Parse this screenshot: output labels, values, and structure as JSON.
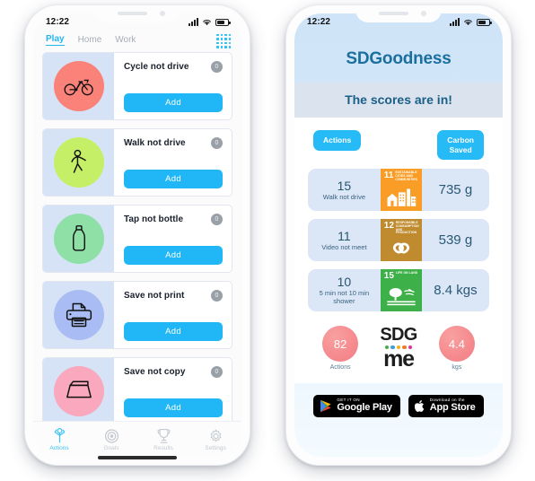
{
  "left_phone": {
    "status": {
      "time": "12:22",
      "signal_icon": "signal-bars-icon",
      "wifi_icon": "wifi-icon",
      "battery_icon": "battery-icon"
    },
    "topnav": {
      "tabs": [
        {
          "label": "Play",
          "active": true
        },
        {
          "label": "Home",
          "active": false
        },
        {
          "label": "Work",
          "active": false
        }
      ],
      "grid_icon": "grid-menu-icon"
    },
    "cards": [
      {
        "title": "Cycle not drive",
        "badge": "0",
        "button": "Add",
        "icon": "bicycle-icon",
        "circle_color": "#fa8279"
      },
      {
        "title": "Walk not drive",
        "badge": "0",
        "button": "Add",
        "icon": "walking-person-icon",
        "circle_color": "#c5ef66"
      },
      {
        "title": "Tap not bottle",
        "badge": "0",
        "button": "Add",
        "icon": "water-bottle-icon",
        "circle_color": "#8fe0a6"
      },
      {
        "title": "Save not print",
        "badge": "0",
        "button": "Add",
        "icon": "printer-icon",
        "circle_color": "#a9bdf4"
      },
      {
        "title": "Save not copy",
        "badge": "0",
        "button": "Add",
        "icon": "photocopier-icon",
        "circle_color": "#f9a8bd"
      }
    ],
    "tabbar": [
      {
        "label": "Actions",
        "icon": "person-actions-icon",
        "active": true
      },
      {
        "label": "Goals",
        "icon": "target-icon",
        "active": false
      },
      {
        "label": "Results",
        "icon": "trophy-icon",
        "active": false
      },
      {
        "label": "Settings",
        "icon": "gear-icon",
        "active": false
      }
    ]
  },
  "right_phone": {
    "status": {
      "time": "12:22",
      "signal_icon": "signal-bars-icon",
      "wifi_icon": "wifi-icon",
      "battery_icon": "battery-icon"
    },
    "app_title": "SDGoodness",
    "banner": "The scores are in!",
    "chips": {
      "actions": "Actions",
      "carbon": "Carbon\nSaved",
      "carbon_line1": "Carbon",
      "carbon_line2": "Saved"
    },
    "score_rows": [
      {
        "count": "15",
        "label": "Walk not drive",
        "value": "735 g",
        "sdg_number": "11",
        "sdg_text": "SUSTAINABLE CITIES AND COMMUNITIES",
        "sdg_color": "#f99d26",
        "sdg_icon": "sdg-cities-icon"
      },
      {
        "count": "11",
        "label": "Video not meet",
        "value": "539 g",
        "sdg_number": "12",
        "sdg_text": "RESPONSIBLE CONSUMPTION AND PRODUCTION",
        "sdg_color": "#bf8b2e",
        "sdg_icon": "sdg-infinity-icon"
      },
      {
        "count": "10",
        "label": "5 min not 10 min shower",
        "value": "8.4 kgs",
        "sdg_number": "15",
        "sdg_text": "LIFE ON LAND",
        "sdg_color": "#3eb049",
        "sdg_icon": "sdg-life-on-land-icon"
      }
    ],
    "totals": {
      "actions_value": "82",
      "actions_label": "Actions",
      "kgs_value": "4.4",
      "kgs_label": "kgs",
      "logo_top": "SDG",
      "logo_bottom": "me",
      "logo_dot_colors": [
        "#4aab4e",
        "#3f9fd8",
        "#f4b223",
        "#f07b2b",
        "#e5318f"
      ]
    },
    "stores": [
      {
        "small": "GET IT ON",
        "big": "Google Play",
        "icon": "google-play-icon"
      },
      {
        "small": "Download on the",
        "big": "App Store",
        "icon": "apple-icon"
      }
    ]
  },
  "theme": {
    "accent_cyan": "#21b7f6",
    "card_thumb_bg": "#d6e3f7",
    "score_row_bg": "#dbe7f7",
    "banner_bg": "#dbe3ee",
    "title_blue": "#1b6f9e"
  }
}
